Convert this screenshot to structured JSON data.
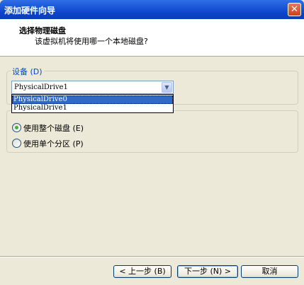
{
  "window": {
    "title": "添加硬件向导",
    "close_glyph": "✕"
  },
  "header": {
    "title": "选择物理磁盘",
    "subtitle": "该虚拟机将使用哪一个本地磁盘?"
  },
  "device_group": {
    "legend": "设备 (D)",
    "selected_value": "PhysicalDrive1",
    "dropdown_options": [
      "PhysicalDrive0",
      "PhysicalDrive1"
    ]
  },
  "usage_group": {
    "options": [
      {
        "label": "使用整个磁盘 (E)",
        "checked": true
      },
      {
        "label": "使用单个分区 (P)",
        "checked": false
      }
    ]
  },
  "buttons": {
    "back": "< 上一步 (B)",
    "next": "下一步 (N) >",
    "cancel": "取消"
  },
  "colors": {
    "titlebar": "#0a3dbd",
    "legend": "#0046d5",
    "selection": "#316ac5",
    "radio_dot": "#3fb13f"
  },
  "icons": {
    "combo_arrow": "chevron-down-icon",
    "close": "close-icon"
  }
}
